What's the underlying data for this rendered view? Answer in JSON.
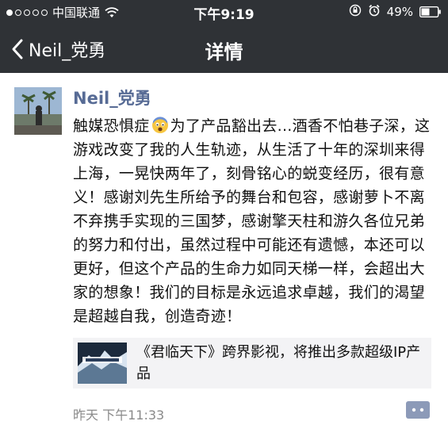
{
  "status_bar": {
    "carrier": "中国联通",
    "time": "下午9:19",
    "battery_percent": "49%",
    "signal_bars_filled": 1,
    "signal_bars_total": 5
  },
  "nav": {
    "back_label": "Neil_党勇",
    "title": "详情"
  },
  "post": {
    "author": "Neil_党勇",
    "text_before_emoji": "触媒恐惧症",
    "emoji_icon": "fearful-face-emoji",
    "text_after_emoji": "为了产品豁出去...酒香不怕巷子深，这游戏改变了我的人生轨迹，从生活了十年的深圳来得上海，一晃快两年了，刻骨铭心的蜕变经历，很有意义！感谢刘先生所给予的舞台和包容，感谢萝卜不离不弃携手实现的三国梦，感谢擎天柱和游久各位兄弟的努力和付出，虽然过程中可能还有遗憾，本还可以更好，但这个产品的生命力如同天梯一样，会超出大家的想象！我们的目标是永远追求卓越，我们的渴望是超越自我，创造奇迹！",
    "link": {
      "title": "《君临天下》跨界影视，将推出多款超级IP产品",
      "thumb_icon": "game-poster-thumbnail"
    },
    "time": "昨天  下午11:33",
    "comment_icon": "comment-icon"
  },
  "colors": {
    "bar_bg": "#2f3236",
    "name_link": "#576b95",
    "card_bg": "#f3f3f5",
    "time_gray": "#8a8a8a"
  }
}
